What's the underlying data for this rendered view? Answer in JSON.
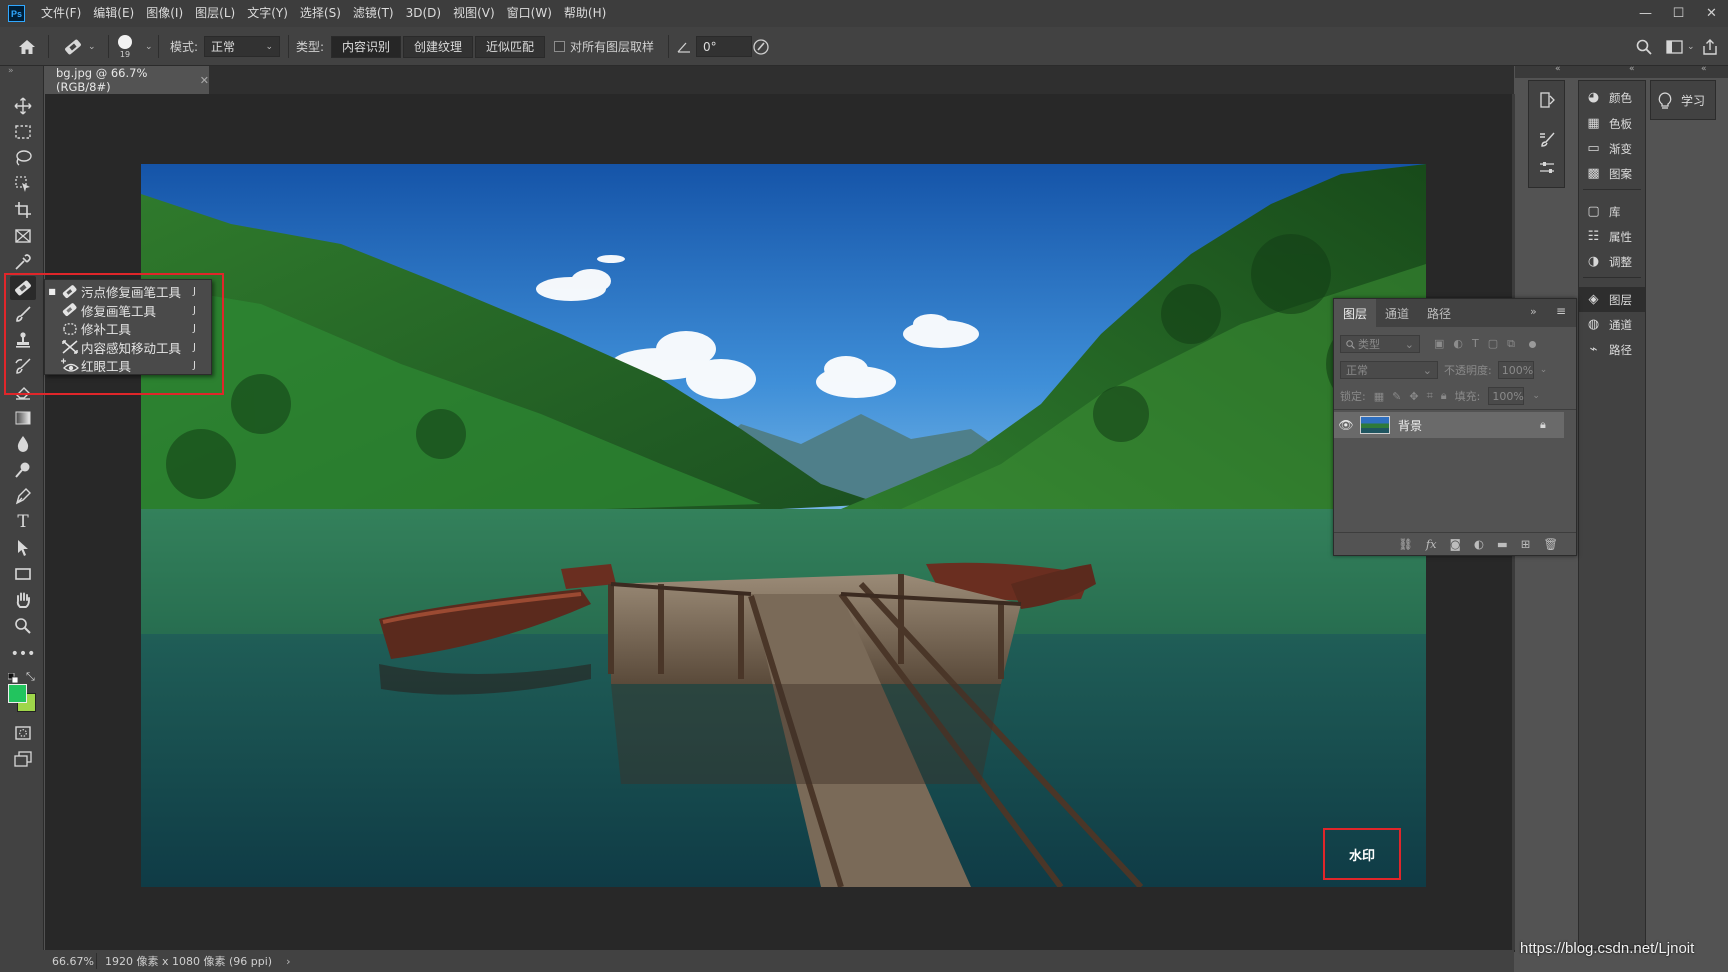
{
  "app": {
    "logo": "Ps",
    "menu": [
      "文件(F)",
      "编辑(E)",
      "图像(I)",
      "图层(L)",
      "文字(Y)",
      "选择(S)",
      "滤镜(T)",
      "3D(D)",
      "视图(V)",
      "窗口(W)",
      "帮助(H)"
    ]
  },
  "options": {
    "brush_size": "19",
    "mode_label": "模式:",
    "mode_value": "正常",
    "type_label": "类型:",
    "type_buttons": [
      "内容识别",
      "创建纹理",
      "近似匹配"
    ],
    "sample_all_label": "对所有图层取样",
    "angle_value": "0°"
  },
  "document": {
    "tab_title": "bg.jpg @ 66.7%(RGB/8#)"
  },
  "flyout": {
    "items": [
      {
        "label": "污点修复画笔工具",
        "key": "J",
        "icon": "spot-healing-brush-icon",
        "active": true
      },
      {
        "label": "修复画笔工具",
        "key": "J",
        "icon": "healing-brush-icon",
        "active": false
      },
      {
        "label": "修补工具",
        "key": "J",
        "icon": "patch-icon",
        "active": false
      },
      {
        "label": "内容感知移动工具",
        "key": "J",
        "icon": "content-aware-move-icon",
        "active": false
      },
      {
        "label": "红眼工具",
        "key": "J",
        "icon": "red-eye-icon",
        "active": false
      }
    ]
  },
  "watermark": {
    "label": "水印"
  },
  "status": {
    "zoom": "66.67%",
    "info": "1920 像素 x 1080 像素 (96 ppi)"
  },
  "dock_mid": [
    "颜色",
    "色板",
    "渐变",
    "图案",
    "库",
    "属性",
    "调整",
    "图层",
    "通道",
    "路径"
  ],
  "dock_learn": "学习",
  "layers_panel": {
    "tabs": [
      "图层",
      "通道",
      "路径"
    ],
    "filter_placeholder": "类型",
    "blend_mode": "正常",
    "opacity_label": "不透明度:",
    "opacity_value": "100%",
    "lock_label": "锁定:",
    "fill_label": "填充:",
    "fill_value": "100%",
    "layers": [
      {
        "name": "背景",
        "visible": true,
        "locked": true
      }
    ]
  },
  "footer_url": "https://blog.csdn.net/Ljnoit",
  "colors": {
    "foreground": "#22c45e",
    "background": "#9fd64a",
    "highlight_box": "#e0262a",
    "ui_dark": "#424242",
    "canvas_bg": "#282828"
  }
}
